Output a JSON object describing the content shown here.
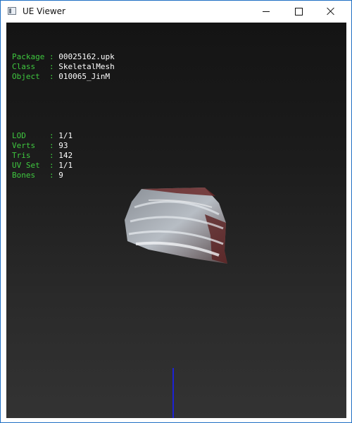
{
  "window": {
    "title": "UE Viewer"
  },
  "info": {
    "rows1": [
      {
        "key": "Package",
        "pad": " ",
        "value": "00025162.upk"
      },
      {
        "key": "Class",
        "pad": "   ",
        "value": "SkeletalMesh"
      },
      {
        "key": "Object",
        "pad": "  ",
        "value": "010065_JinM"
      }
    ],
    "rows2": [
      {
        "key": "LOD",
        "pad": "     ",
        "value": "1/1"
      },
      {
        "key": "Verts",
        "pad": "   ",
        "value": "93"
      },
      {
        "key": "Tris",
        "pad": "    ",
        "value": "142"
      },
      {
        "key": "UV Set",
        "pad": "  ",
        "value": "1/1"
      },
      {
        "key": "Bones",
        "pad": "   ",
        "value": "9"
      }
    ]
  },
  "colors": {
    "label": "#3fc83f",
    "value": "#ffffff",
    "axis": "#1d22d4",
    "border": "#1f70c4"
  },
  "icons": [
    "app-icon",
    "minimize-icon",
    "maximize-icon",
    "close-icon"
  ]
}
